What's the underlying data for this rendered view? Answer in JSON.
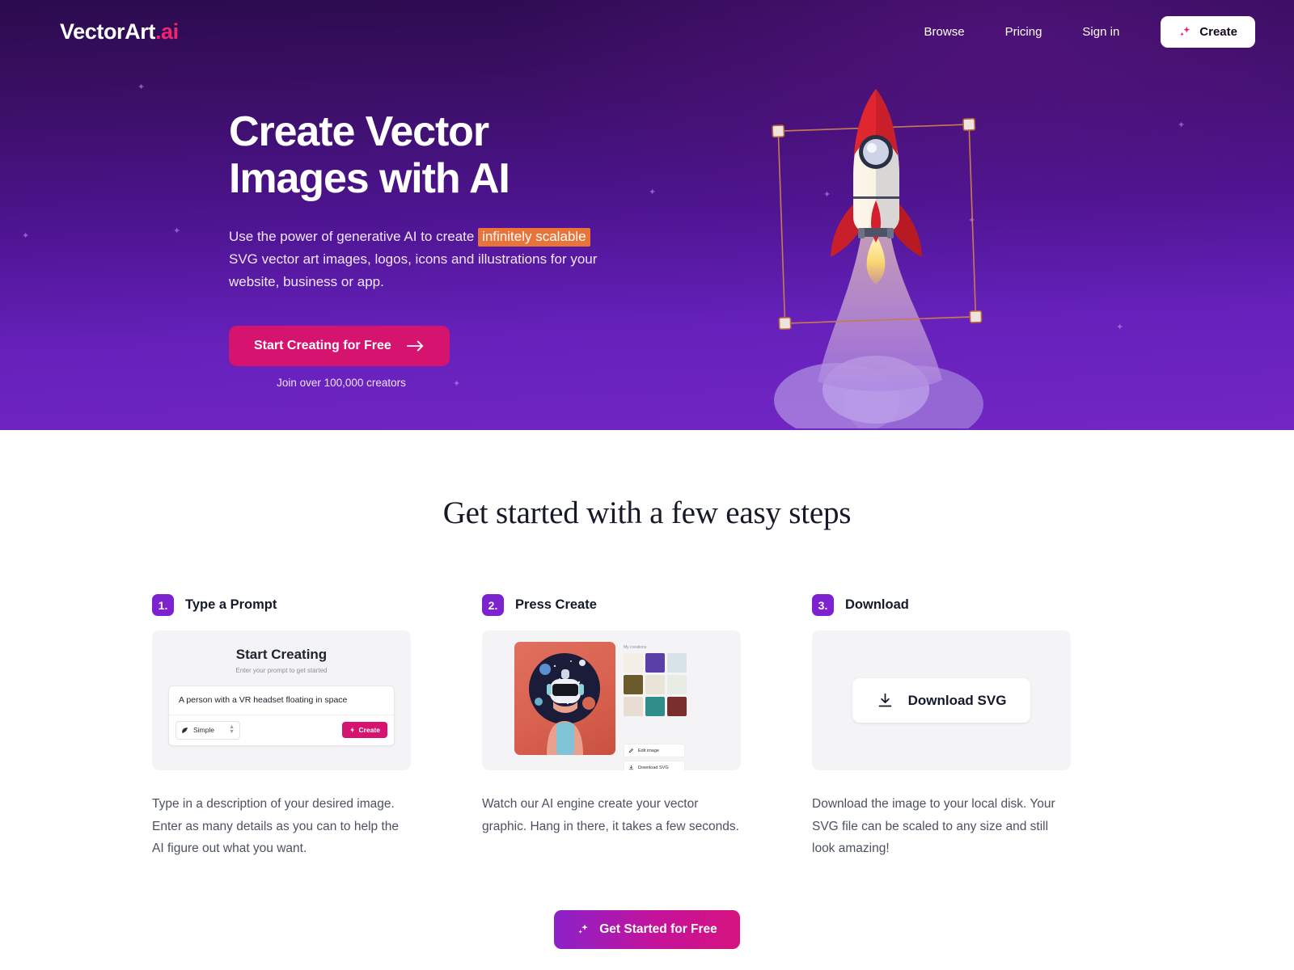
{
  "brand": {
    "name": "VectorArt",
    "suffix": ".ai",
    "accent_pink": "#f0256f",
    "accent_purple": "#7c22ce"
  },
  "nav": {
    "links": [
      {
        "label": "Browse"
      },
      {
        "label": "Pricing"
      },
      {
        "label": "Sign in"
      }
    ],
    "create_button": {
      "label": "Create",
      "icon": "sparkle-icon"
    }
  },
  "hero": {
    "title_line1": "Create Vector",
    "title_line2": "Images with AI",
    "sub_before": "Use the power of generative AI to create ",
    "sub_highlight": "infinitely scalable",
    "sub_after": " SVG vector art images, logos, icons and illustrations for your website, business or app.",
    "cta_label": "Start Creating for Free",
    "cta_icon": "arrow-right-icon",
    "cta_note": "Join over 100,000 creators",
    "illustration": "rocket-launch-with-selection-box",
    "highlight_color": "#e8743a",
    "cta_color": "#d6136e"
  },
  "steps_section": {
    "title": "Get started with a few easy steps",
    "cards": [
      {
        "number": "1.",
        "title": "Type a Prompt",
        "description": "Type in a description of your desired image. Enter as many details as you can to help the AI figure out what you want.",
        "mock": {
          "heading": "Start Creating",
          "subheading": "Enter your prompt to get started",
          "prompt_value": "A person with a VR headset floating in space",
          "style_select": "Simple",
          "create_label": "Create"
        }
      },
      {
        "number": "2.",
        "title": "Press Create",
        "description": "Watch our AI engine create your vector graphic. Hang in there, it takes a few seconds.",
        "mock": {
          "creations_label": "My creations",
          "edit_label": "Edit image",
          "download_label": "Download SVG",
          "thumb_colors": [
            "#f3eee6",
            "#5b3fa8",
            "#d8e3ea",
            "#6b5a2a",
            "#e9e4d6",
            "#e7ece4",
            "#e9ddd1",
            "#2f8d8a",
            "#7a2f2f"
          ]
        }
      },
      {
        "number": "3.",
        "title": "Download",
        "description": "Download the image to your local disk. Your SVG file can be scaled to any size and still look amazing!",
        "mock": {
          "download_label": "Download SVG",
          "download_icon": "download-icon"
        }
      }
    ],
    "bottom_cta": {
      "label": "Get Started for Free",
      "icon": "sparkle-icon"
    }
  }
}
